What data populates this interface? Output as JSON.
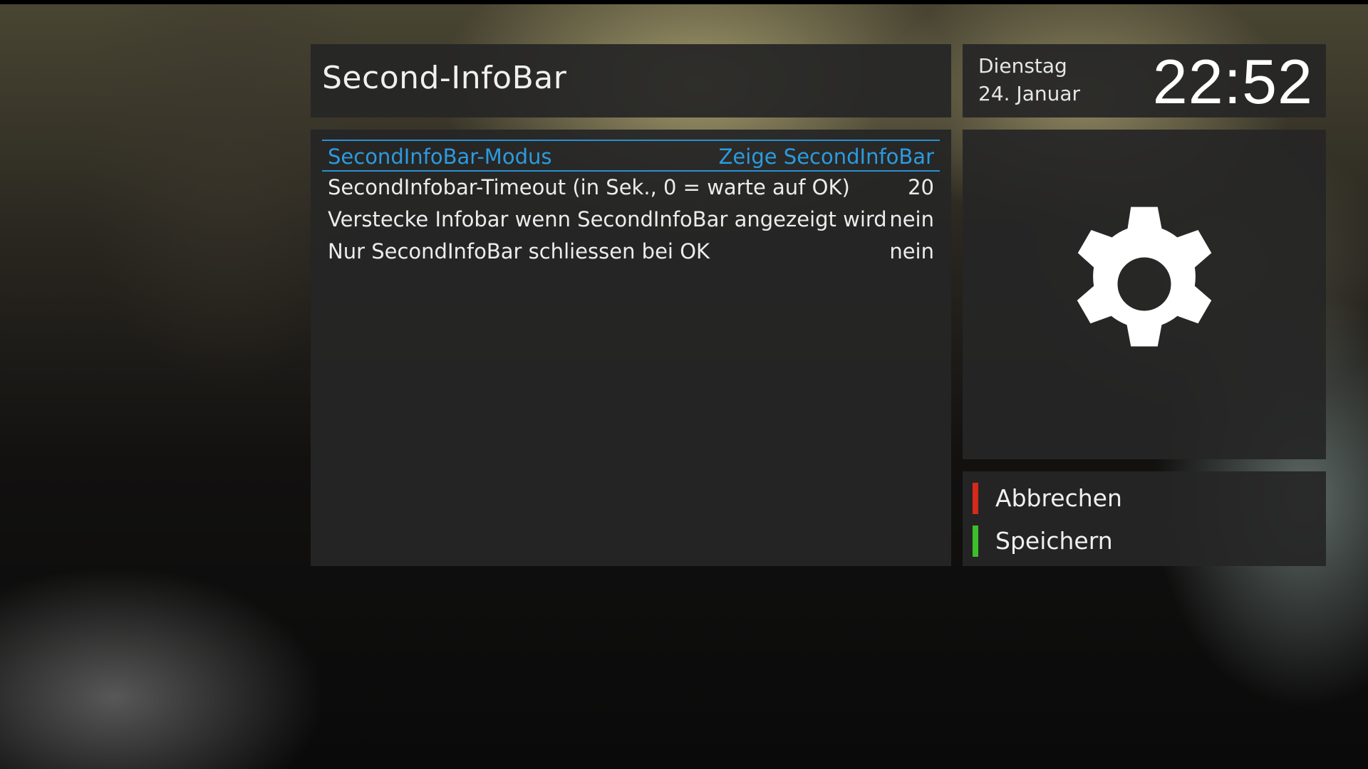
{
  "header": {
    "title": "Second-InfoBar"
  },
  "clock": {
    "day": "Dienstag",
    "date": "24. Januar",
    "time": "22:52"
  },
  "config_list": {
    "items": [
      {
        "label": "SecondInfoBar-Modus",
        "value": "Zeige SecondInfoBar",
        "selected": true
      },
      {
        "label": "SecondInfobar-Timeout (in Sek., 0 = warte auf OK)",
        "value": "20",
        "selected": false
      },
      {
        "label": "Verstecke Infobar wenn SecondInfoBar angezeigt wird",
        "value": "nein",
        "selected": false
      },
      {
        "label": "Nur SecondInfoBar schliessen bei OK",
        "value": "nein",
        "selected": false
      }
    ]
  },
  "side_icon": {
    "name": "gear-icon"
  },
  "color_keys": {
    "red": {
      "label": "Abbrechen",
      "color": "#d42a1c"
    },
    "green": {
      "label": "Speichern",
      "color": "#3cbf2a"
    }
  },
  "colors": {
    "selection_accent": "#2b9be0",
    "panel_background": "#262626"
  }
}
